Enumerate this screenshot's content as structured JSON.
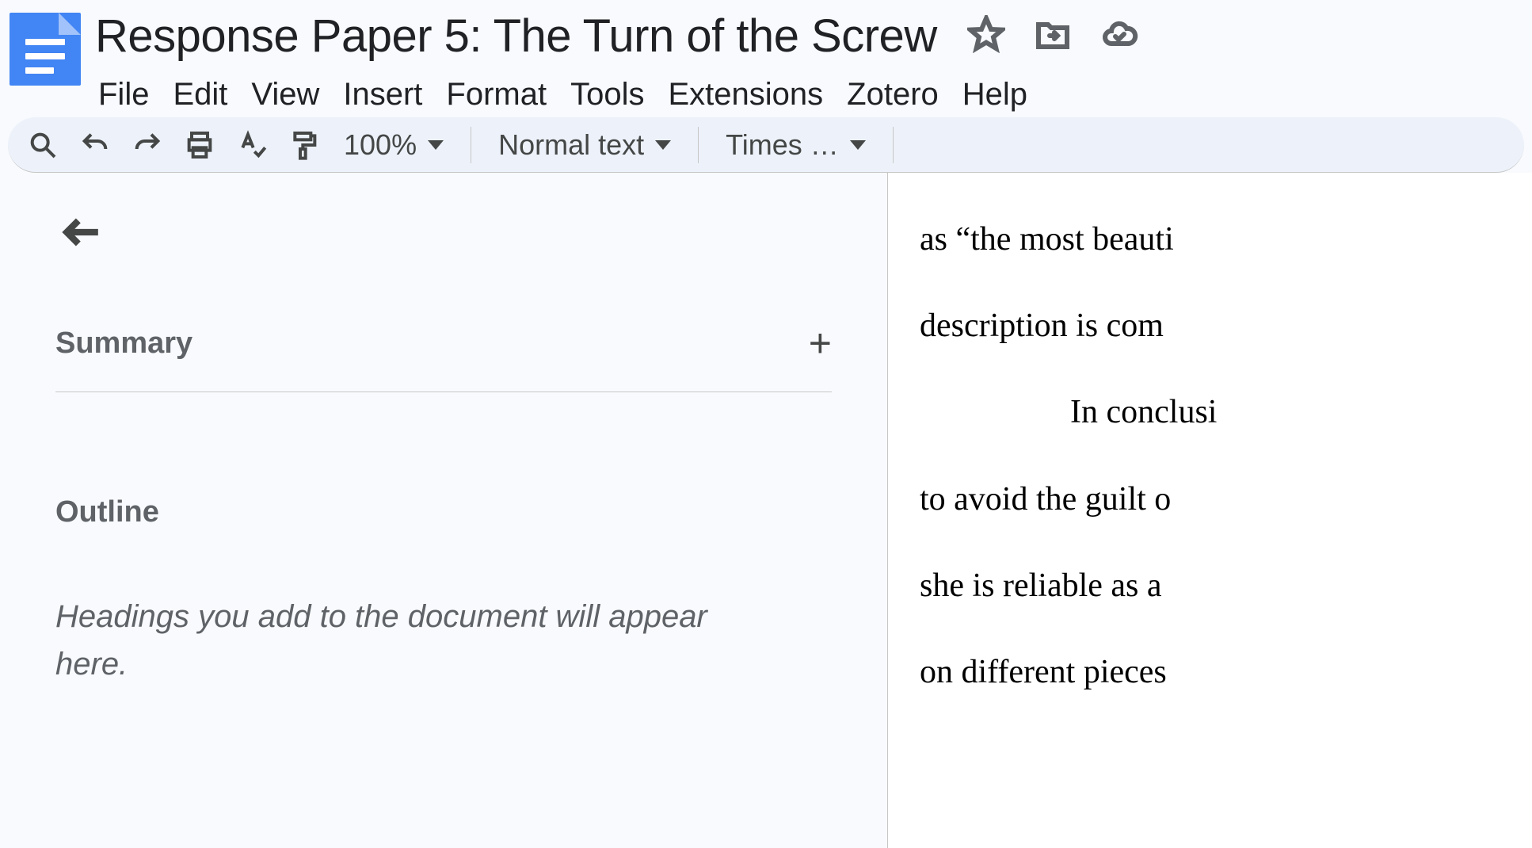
{
  "header": {
    "title": "Response Paper 5: The Turn of the Screw"
  },
  "menubar": {
    "items": [
      "File",
      "Edit",
      "View",
      "Insert",
      "Format",
      "Tools",
      "Extensions",
      "Zotero",
      "Help"
    ]
  },
  "toolbar": {
    "zoom": "100%",
    "style": "Normal text",
    "font": "Times …"
  },
  "sidebar": {
    "summary_label": "Summary",
    "outline_label": "Outline",
    "outline_empty": "Headings you add to the document will appear here."
  },
  "document": {
    "lines": [
      "as “the most beauti",
      "description is com",
      "In conclusi",
      "to avoid the guilt o",
      "she is reliable as a",
      "on different pieces"
    ]
  }
}
